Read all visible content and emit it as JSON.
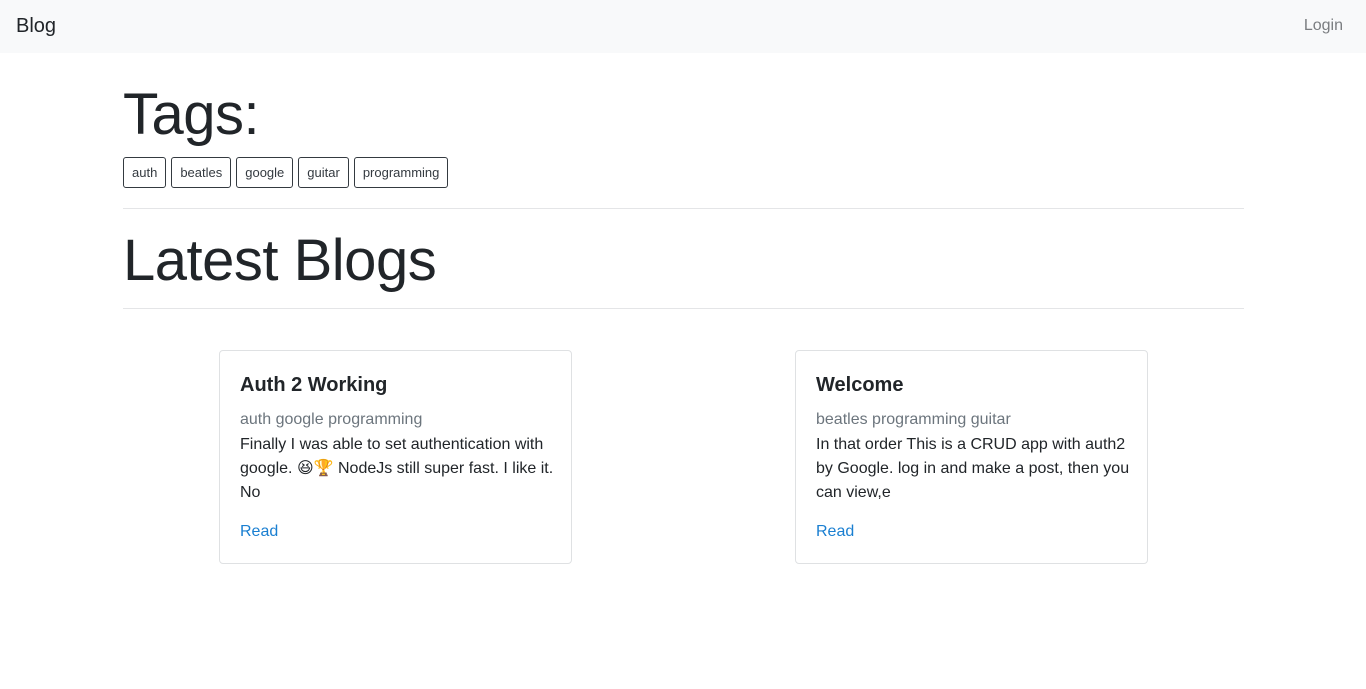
{
  "navbar": {
    "brand": "Blog",
    "login_label": "Login"
  },
  "tags_section": {
    "heading": "Tags:",
    "tags": [
      "auth",
      "beatles",
      "google",
      "guitar",
      "programming"
    ]
  },
  "latest_section": {
    "heading": "Latest Blogs"
  },
  "posts": [
    {
      "title": "Auth 2 Working",
      "tags": "auth google programming",
      "excerpt": "Finally I was able to set authentication with google. 😆🏆 NodeJs still super fast. I like it. No",
      "link_label": "Read"
    },
    {
      "title": "Welcome",
      "tags": "beatles programming guitar",
      "excerpt": "In that order This is a CRUD app with auth2 by Google. log in and make a post, then you can view,e",
      "link_label": "Read"
    }
  ],
  "colors": {
    "navbar_bg": "#f8f9fa",
    "link": "#1a7fd1",
    "muted": "#6c757d",
    "text": "#212529"
  }
}
